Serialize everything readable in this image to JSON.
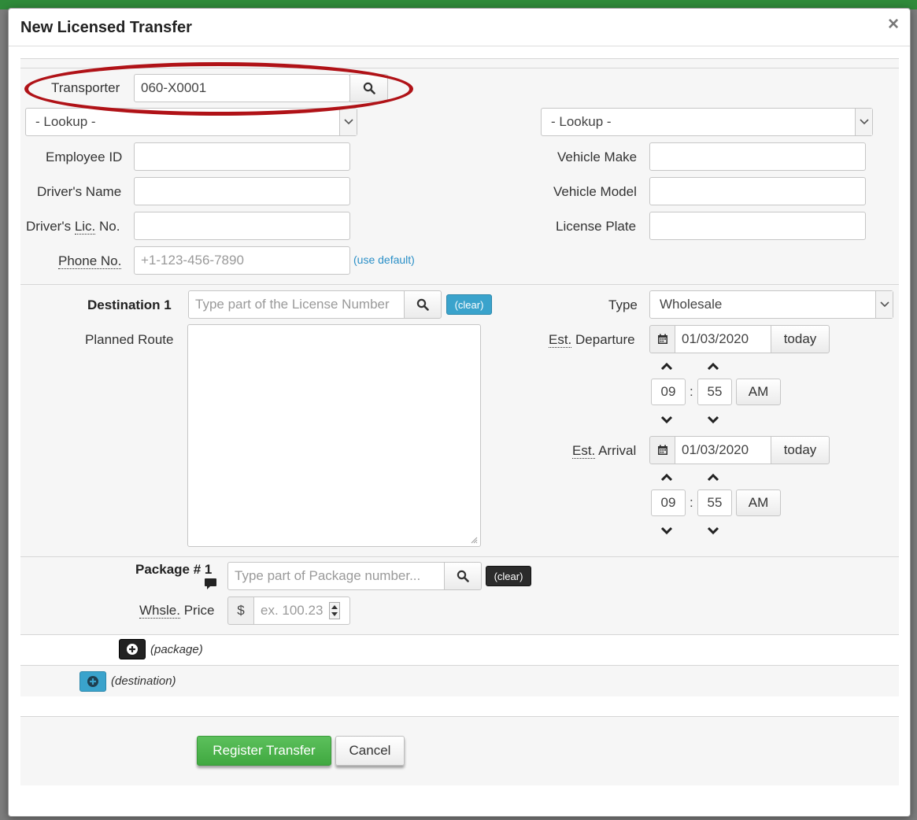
{
  "modal": {
    "title": "New Licensed Transfer",
    "close": "×"
  },
  "transporter": {
    "label": "Transporter",
    "value": "060-X0001",
    "left_lookup": "- Lookup -",
    "right_lookup": "- Lookup -",
    "employee_id_label": "Employee ID",
    "drivers_name_label": "Driver's Name",
    "drivers_lic_label_a": "Driver's ",
    "drivers_lic_label_b": "Lic.",
    "drivers_lic_label_c": " No.",
    "phone_label": "Phone No.",
    "phone_placeholder": "+1-123-456-7890",
    "use_default": "(use default)",
    "vehicle_make_label": "Vehicle Make",
    "vehicle_model_label": "Vehicle Model",
    "license_plate_label": "License Plate"
  },
  "destination": {
    "label": "Destination 1",
    "placeholder": "Type part of the License Number",
    "clear": "(clear)",
    "planned_route_label": "Planned Route",
    "type_label": "Type",
    "type_value": "Wholesale",
    "departure_label_a": "Est.",
    "departure_label_b": " Departure",
    "departure_date": "01/03/2020",
    "departure_hour": "09",
    "departure_minute": "55",
    "departure_ampm": "AM",
    "arrival_label_a": "Est.",
    "arrival_label_b": " Arrival",
    "arrival_date": "01/03/2020",
    "arrival_hour": "09",
    "arrival_minute": "55",
    "arrival_ampm": "AM",
    "today": "today",
    "colon": ":"
  },
  "package": {
    "label": "Package # 1",
    "placeholder": "Type part of Package number...",
    "clear": "(clear)",
    "price_label_a": "Whsle.",
    "price_label_b": " Price",
    "currency": "$",
    "price_placeholder": "ex. 100.23",
    "add_package": "(package)",
    "add_destination": "(destination)"
  },
  "footer": {
    "register": "Register Transfer",
    "cancel": "Cancel"
  },
  "colors": {
    "accent_annotation": "#b01217",
    "primary": "#4cae4c",
    "info": "#3aa3cc"
  }
}
